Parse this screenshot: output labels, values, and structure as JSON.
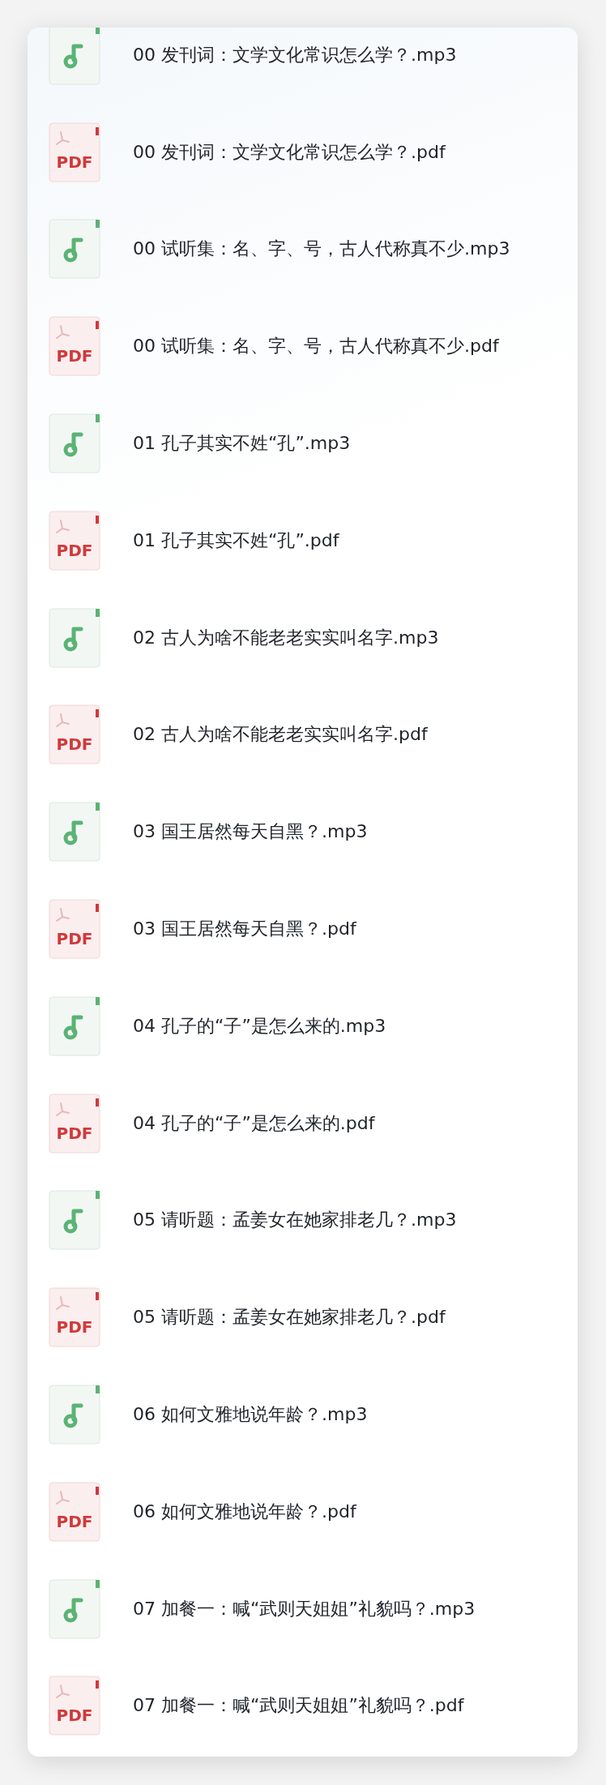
{
  "files": [
    {
      "kind": "mp3",
      "name": "00 发刊词：文学文化常识怎么学？.mp3"
    },
    {
      "kind": "pdf",
      "icon_label": "PDF",
      "name": "00 发刊词：文学文化常识怎么学？.pdf"
    },
    {
      "kind": "mp3",
      "name": "00 试听集：名、字、号，古人代称真不少.mp3"
    },
    {
      "kind": "pdf",
      "icon_label": "PDF",
      "name": "00 试听集：名、字、号，古人代称真不少.pdf"
    },
    {
      "kind": "mp3",
      "name": "01 孔子其实不姓“孔”.mp3"
    },
    {
      "kind": "pdf",
      "icon_label": "PDF",
      "name": "01 孔子其实不姓“孔”.pdf"
    },
    {
      "kind": "mp3",
      "name": "02 古人为啥不能老老实实叫名字.mp3"
    },
    {
      "kind": "pdf",
      "icon_label": "PDF",
      "name": "02 古人为啥不能老老实实叫名字.pdf"
    },
    {
      "kind": "mp3",
      "name": "03 国王居然每天自黑？.mp3"
    },
    {
      "kind": "pdf",
      "icon_label": "PDF",
      "name": "03 国王居然每天自黑？.pdf"
    },
    {
      "kind": "mp3",
      "name": "04 孔子的“子”是怎么来的.mp3"
    },
    {
      "kind": "pdf",
      "icon_label": "PDF",
      "name": "04 孔子的“子”是怎么来的.pdf"
    },
    {
      "kind": "mp3",
      "name": "05 请听题：孟姜女在她家排老几？.mp3"
    },
    {
      "kind": "pdf",
      "icon_label": "PDF",
      "name": "05 请听题：孟姜女在她家排老几？.pdf"
    },
    {
      "kind": "mp3",
      "name": "06 如何文雅地说年龄？.mp3"
    },
    {
      "kind": "pdf",
      "icon_label": "PDF",
      "name": "06 如何文雅地说年龄？.pdf"
    },
    {
      "kind": "mp3",
      "name": "07 加餐一：喊“武则天姐姐”礼貌吗？.mp3"
    },
    {
      "kind": "pdf",
      "icon_label": "PDF",
      "name": "07 加餐一：喊“武则天姐姐”礼貌吗？.pdf"
    }
  ]
}
